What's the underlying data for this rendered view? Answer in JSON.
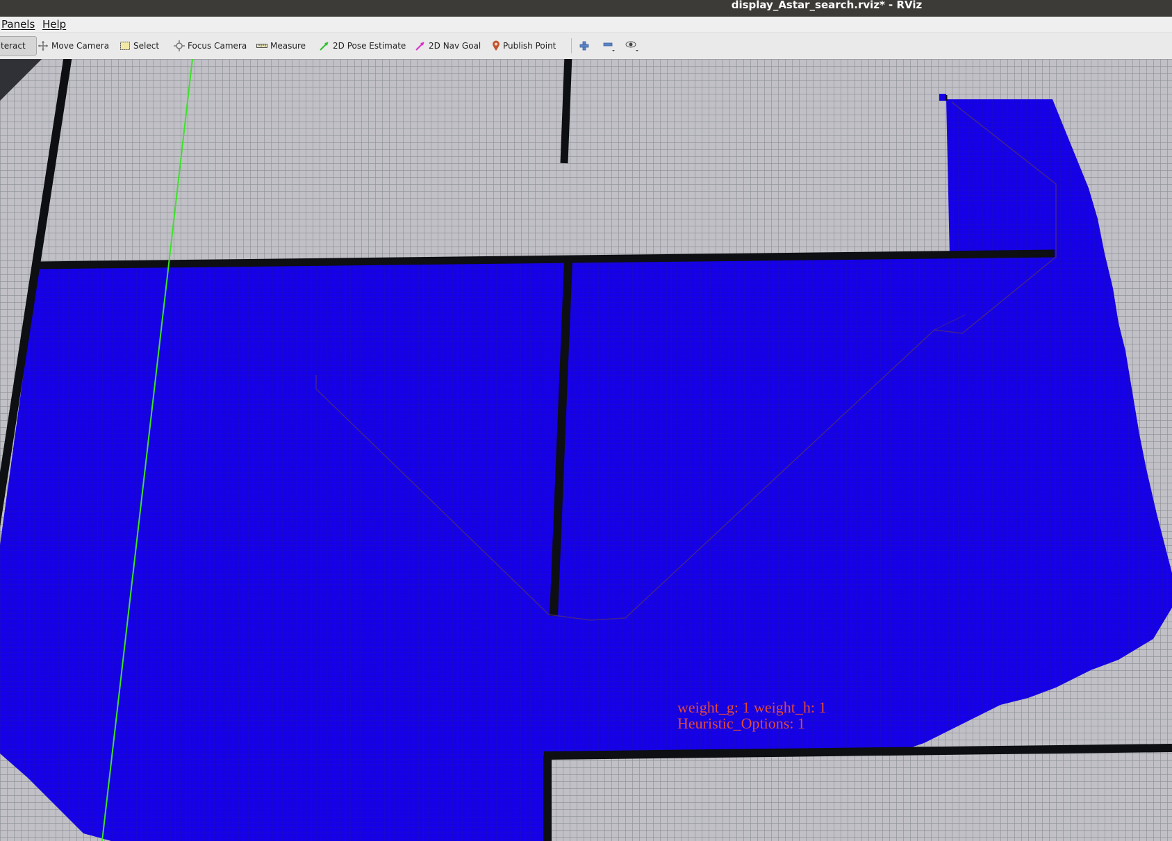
{
  "window": {
    "title": "display_Astar_search.rviz* - RViz"
  },
  "menubar": {
    "items": [
      {
        "label_first": "P",
        "label_rest": "anels"
      },
      {
        "label_first": "H",
        "label_rest": "elp"
      }
    ]
  },
  "toolbar": {
    "interact_label": "teract",
    "move_camera_label": "Move Camera",
    "select_label": "Select",
    "focus_camera_label": "Focus Camera",
    "measure_label": "Measure",
    "pose_estimate_label": "2D Pose Estimate",
    "nav_goal_label": "2D Nav Goal",
    "publish_point_label": "Publish Point",
    "icons": [
      "move-camera-icon",
      "select-icon",
      "focus-camera-icon",
      "measure-icon",
      "pose-estimate-icon",
      "nav-goal-icon",
      "publish-point-icon",
      "add-tool-icon",
      "remove-tool-icon",
      "view-options-icon"
    ]
  },
  "overlay": {
    "line1": "weight_g: 1 weight_h: 1",
    "line2": "Heuristic_Options: 1",
    "color": "#e24a3a"
  },
  "scene": {
    "free_cell_color": "#c0c0c6",
    "searched_cell_color": "#1500e8",
    "wall_color": "#0d0f12",
    "axis_color": "#3de22a",
    "path_color": "#4a2a7a"
  }
}
